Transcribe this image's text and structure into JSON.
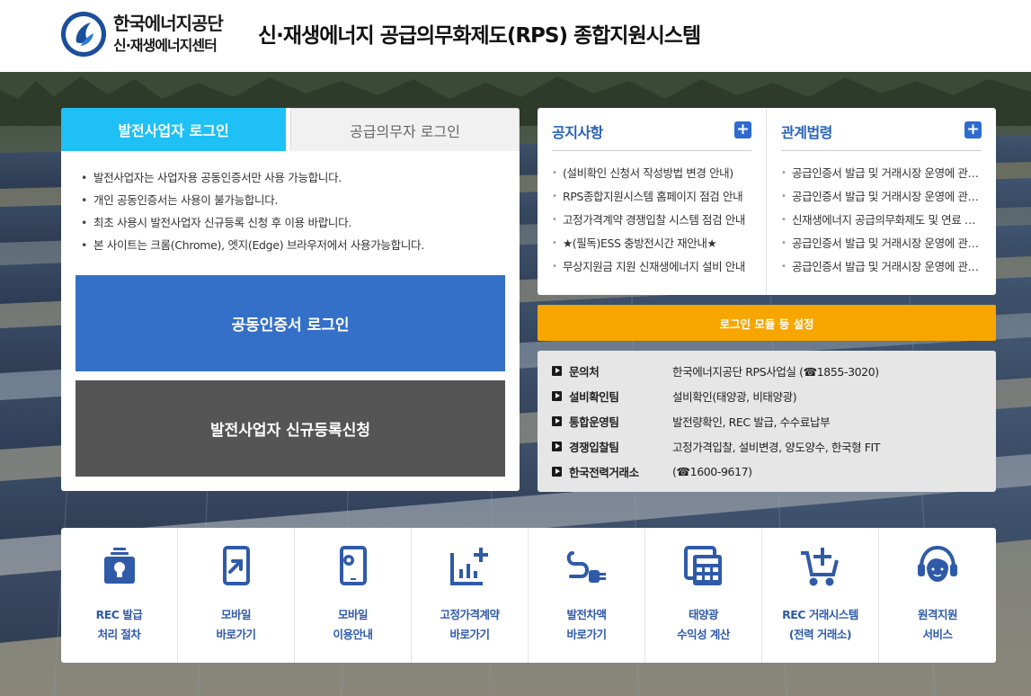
{
  "header": {
    "org_name": "한국에너지공단",
    "org_sub": "신·재생에너지센터",
    "site_title": "신·재생에너지 공급의무화제도(RPS) 종합지원시스템"
  },
  "login": {
    "tabs": [
      {
        "label": "발전사업자 로그인",
        "active": true
      },
      {
        "label": "공급의무자 로그인",
        "active": false
      }
    ],
    "notices": [
      "발전사업자는 사업자용 공동인증서만 사용 가능합니다.",
      "개인 공동인증서는 사용이 불가능합니다.",
      "최초 사용시 발전사업자 신규등록 신청 후 이용 바랍니다.",
      "본 사이트는 크롬(Chrome), 엣지(Edge) 브라우저에서 사용가능합니다."
    ],
    "cert_login_label": "공동인증서 로그인",
    "register_label": "발전사업자 신규등록신청"
  },
  "boards": {
    "notice": {
      "title": "공지사항",
      "plus": "+",
      "items": [
        "(설비확인 신청서 작성방법 변경 안내)",
        "RPS종합지원시스템 홈페이지 점검 안내",
        "고정가격계약 경쟁입찰 시스템 점검 안내",
        "★(필독)ESS 충방전시간 재안내★",
        "무상지원금 지원 신재생에너지 설비 안내"
      ]
    },
    "law": {
      "title": "관계법령",
      "plus": "+",
      "items": [
        "공급인증서 발급 및 거래시장 운영에 관한 규칙",
        "공급인증서 발급 및 거래시장 운영에 관한 규칙",
        "신재생에너지 공급의무화제도 및 연료 혼합의무화제도 관리·운영지침",
        "공급인증서 발급 및 거래시장 운영에 관한 규칙",
        "공급인증서 발급 및 거래시장 운영에 관한 규칙"
      ]
    }
  },
  "module_setup_label": "로그인 모듈 등 설정",
  "contacts": [
    {
      "label": "문의처",
      "value": "한국에너지공단 RPS사업실 (☎1855-3020)"
    },
    {
      "label": "설비확인팀",
      "value": "설비확인(태양광, 비태양광)"
    },
    {
      "label": "통합운영팀",
      "value": "발전량확인, REC 발급, 수수료납부"
    },
    {
      "label": "경쟁입찰팀",
      "value": "고정가격입찰, 설비변경, 양도양수, 한국형 FIT"
    },
    {
      "label": "한국전력거래소",
      "value": "(☎1600-9617)"
    }
  ],
  "quick_links": [
    {
      "icon": "rec-issue-icon",
      "line1": "REC 발급",
      "line2": "처리 절차"
    },
    {
      "icon": "mobile-link-icon",
      "line1": "모바일",
      "line2": "바로가기"
    },
    {
      "icon": "mobile-gear-icon",
      "line1": "모바일",
      "line2": "이용안내"
    },
    {
      "icon": "chart-plus-icon",
      "line1": "고정가격계약",
      "line2": "바로가기"
    },
    {
      "icon": "plug-icon",
      "line1": "발전차액",
      "line2": "바로가기"
    },
    {
      "icon": "calculator-icon",
      "line1": "태양광",
      "line2": "수익성 계산"
    },
    {
      "icon": "cart-plus-icon",
      "line1": "REC 거래시스템",
      "line2": "(전력 거래소)"
    },
    {
      "icon": "headset-icon",
      "line1": "원격지원",
      "line2": "서비스"
    }
  ],
  "colors": {
    "accent_blue": "#3470c8",
    "tab_active": "#1ec0f5",
    "module_bar": "#f7a600",
    "icon_blue": "#2f5aa8"
  }
}
